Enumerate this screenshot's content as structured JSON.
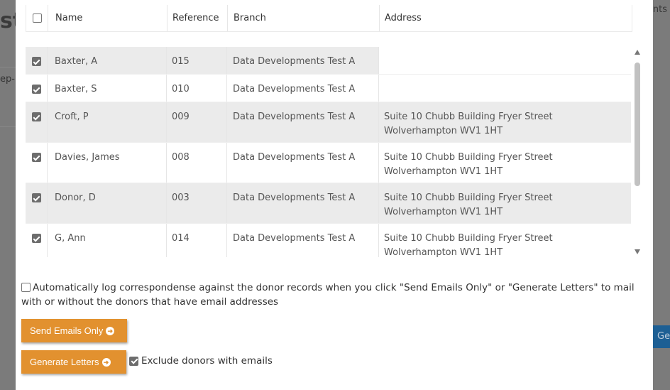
{
  "background": {
    "title_fragment": "sta",
    "subtitle_fragment": "ep-",
    "right_text_fragment": "nts",
    "right_button_fragment": "Ge"
  },
  "table": {
    "headers": [
      "Name",
      "Reference",
      "Branch",
      "Address"
    ],
    "select_all_checked": false,
    "rows": [
      {
        "checked": true,
        "name": "Baxter, A",
        "reference": "015",
        "branch": "Data Developments Test A",
        "address": ""
      },
      {
        "checked": true,
        "name": "Baxter, S",
        "reference": "010",
        "branch": "Data Developments Test A",
        "address": ""
      },
      {
        "checked": true,
        "name": "Croft, P",
        "reference": "009",
        "branch": "Data Developments Test A",
        "address": "Suite 10 Chubb Building Fryer Street Wolverhampton WV1 1HT"
      },
      {
        "checked": true,
        "name": "Davies, James",
        "reference": "008",
        "branch": "Data Developments Test A",
        "address": "Suite 10 Chubb Building Fryer Street Wolverhampton WV1 1HT"
      },
      {
        "checked": true,
        "name": "Donor, D",
        "reference": "003",
        "branch": "Data Developments Test A",
        "address": "Suite 10 Chubb Building Fryer Street Wolverhampton WV1 1HT"
      },
      {
        "checked": true,
        "name": "G, Ann",
        "reference": "014",
        "branch": "Data Developments Test A",
        "address": "Suite 10 Chubb Building Fryer Street Wolverhampton WV1 1HT"
      }
    ]
  },
  "options": {
    "auto_log_label": "Automatically log correspondense against the donor records when you click \"Send Emails Only\" or \"Generate Letters\" to mail with or without the donors that have email addresses",
    "auto_log_checked": false,
    "exclude_label": "Exclude donors with emails",
    "exclude_checked": true
  },
  "buttons": {
    "send_emails_label": "Send Emails Only",
    "generate_letters_label": "Generate Letters"
  },
  "colors": {
    "accent": "#e2912f",
    "overlay": "#7b7b7b",
    "row_shade": "#ebebeb"
  },
  "icons": {
    "button_arrow": "circle-arrow-right-icon"
  }
}
